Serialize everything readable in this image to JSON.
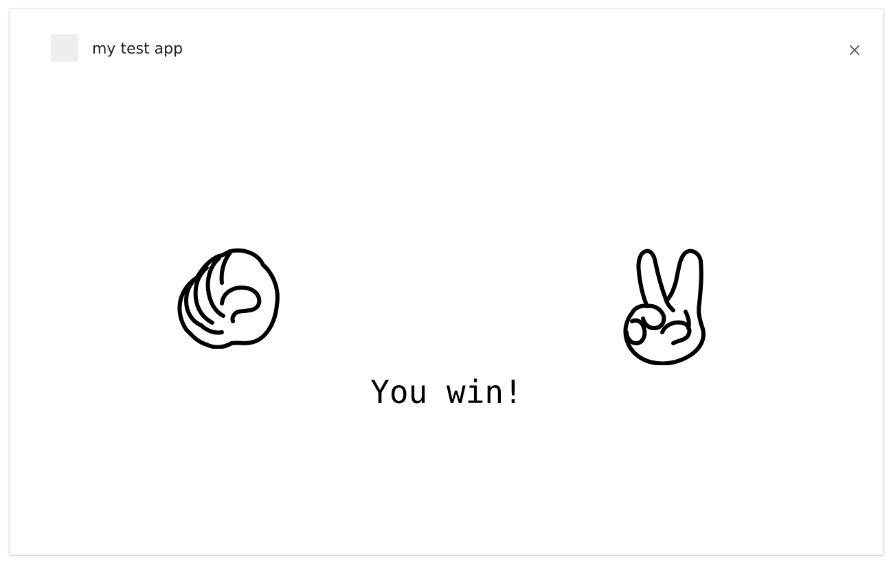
{
  "window": {
    "title": "my test app",
    "close_icon": "close-icon",
    "app_icon": "app-icon-placeholder"
  },
  "game": {
    "player_hand": "rock",
    "opponent_hand": "scissors",
    "result": "You win!"
  }
}
